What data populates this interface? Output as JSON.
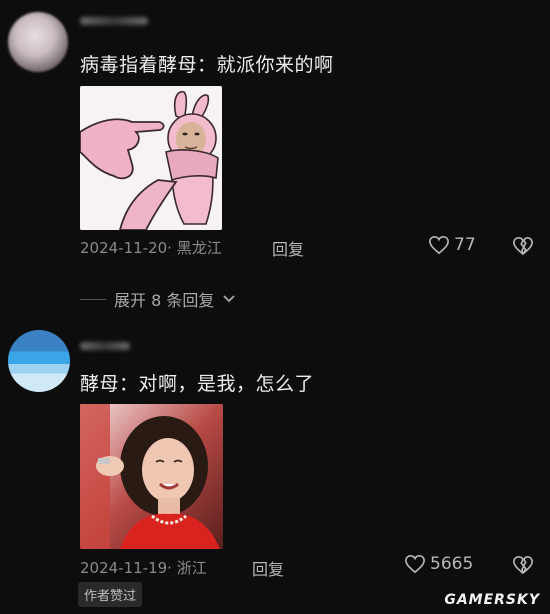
{
  "comments": [
    {
      "text": "病毒指着酵母：就派你来的啊",
      "date_location": "2024-11-20· 黑龙江",
      "reply_label": "回复",
      "likes": "77"
    },
    {
      "text": "酵母：对啊，是我，怎么了",
      "date_location": "2024-11-19· 浙江",
      "reply_label": "回复",
      "likes": "5665",
      "badge": "作者赞过"
    }
  ],
  "expand_label": "展开 8 条回复",
  "watermark": "GAMERSKY",
  "colors": {
    "background": "#0d0d0d",
    "text": "#ededed",
    "meta": "#8a8a8a"
  },
  "icons": [
    "heart-outline-icon",
    "broken-heart-icon",
    "chevron-down-icon"
  ]
}
